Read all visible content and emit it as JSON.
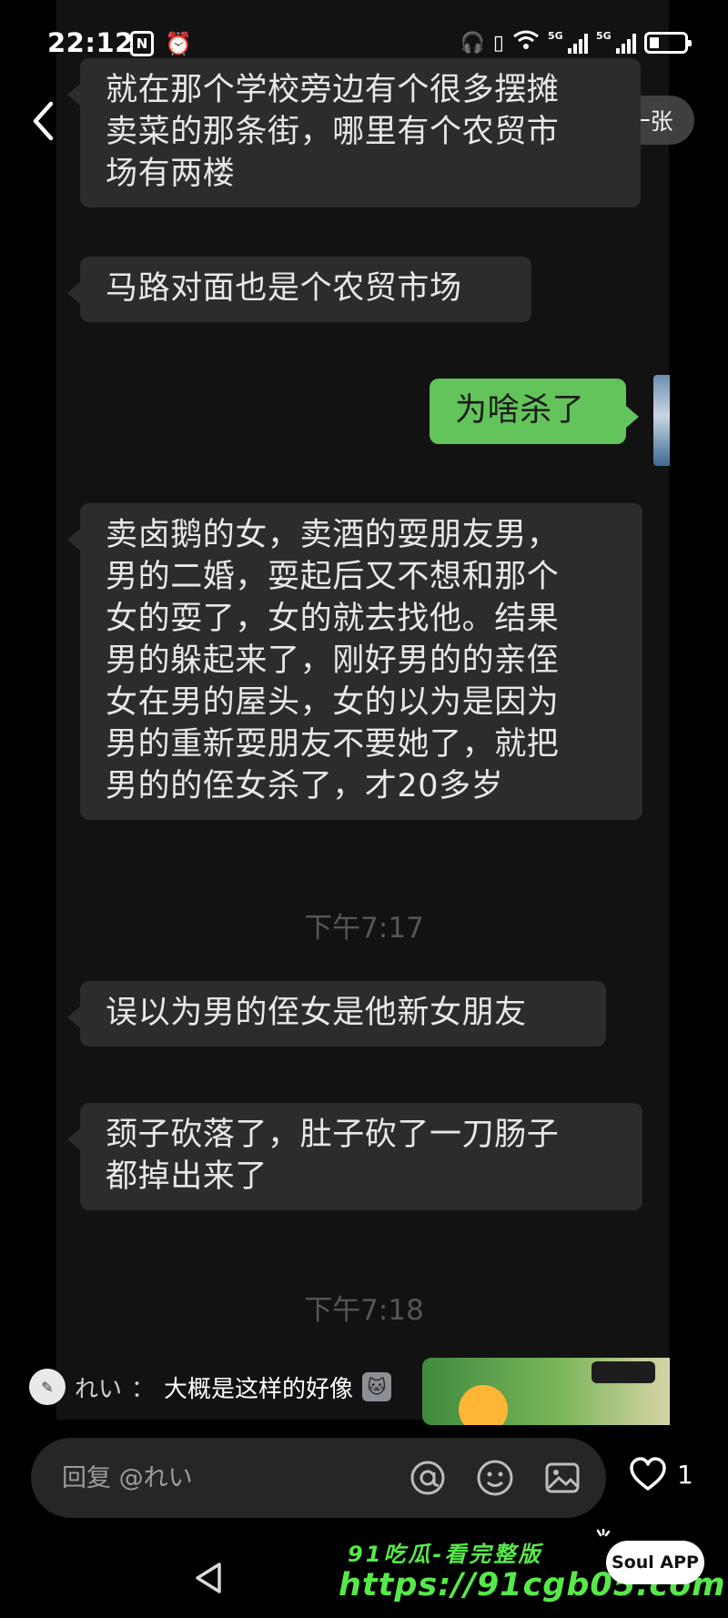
{
  "status_bar": {
    "time": "22:12",
    "nfc": "N",
    "network_1": "5G",
    "network_2": "5G"
  },
  "header": {
    "me_too_label": "我也发一张"
  },
  "messages": [
    {
      "side": "in",
      "text": "就在那个学校旁边有个很多摆摊\n卖菜的那条街，哪里有个农贸市\n场有两楼"
    },
    {
      "side": "in",
      "text": "马路对面也是个农贸市场"
    },
    {
      "side": "out",
      "text": "为啥杀了"
    },
    {
      "side": "in",
      "text": "卖卤鹅的女，卖酒的耍朋友男，\n男的二婚，耍起后又不想和那个\n女的耍了，女的就去找他。结果\n男的躲起来了，刚好男的的亲侄\n女在男的屋头，女的以为是因为\n男的重新耍朋友不要她了，就把\n男的的侄女杀了，才20多岁"
    },
    {
      "side": "in",
      "text": "误以为男的侄女是他新女朋友"
    },
    {
      "side": "in",
      "text": "颈子砍落了，肚子砍了一刀肠子\n都掉出来了"
    }
  ],
  "timestamps": [
    "下午7:17",
    "下午7:18"
  ],
  "comment": {
    "author": "れい",
    "separator": "：",
    "text": "大概是这样的好像"
  },
  "reply_bar": {
    "placeholder": "回复 @れい"
  },
  "like": {
    "count": "1"
  },
  "watermark": {
    "line1": "91吃瓜-看完整版",
    "line2": "https://91cgb05.com",
    "badge": "Soul APP"
  },
  "colors": {
    "outgoing_bubble": "#62c45b",
    "incoming_bubble": "#2c2c2c",
    "watermark": "#57e84a"
  }
}
